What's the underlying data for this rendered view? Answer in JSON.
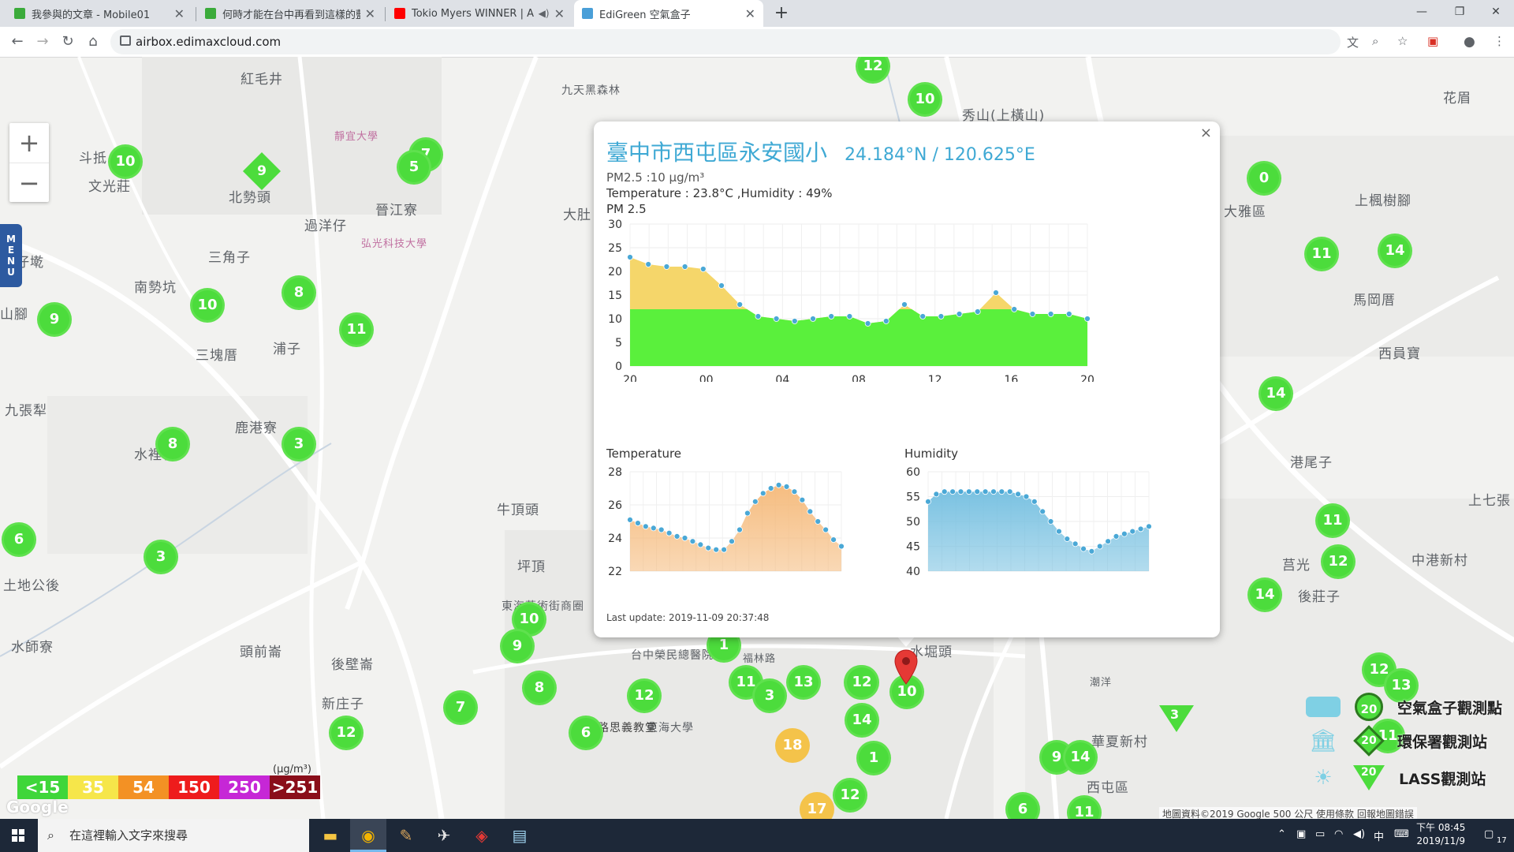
{
  "browser": {
    "tabs": [
      {
        "title": "我參與的文章 - Mobile01",
        "favicon_color": "#3bab3b"
      },
      {
        "title": "何時才能在台中再看到這樣的藍天",
        "favicon_color": "#3bab3b"
      },
      {
        "title": "Tokio Myers WINNER | ALL",
        "favicon_color": "#ff0000"
      },
      {
        "title": "EdiGreen 空氣盒子",
        "favicon_color": "#4a9fd8"
      }
    ],
    "url": "airbox.edimaxcloud.com"
  },
  "map": {
    "zoom_in": "+",
    "zoom_out": "−",
    "menu_label": [
      "M",
      "E",
      "N",
      "U"
    ],
    "places": [
      {
        "text": "紅毛井"
      },
      {
        "text": "斗抵"
      },
      {
        "text": "文光莊"
      },
      {
        "text": "北勢頭"
      },
      {
        "text": "過洋仔"
      },
      {
        "text": "晉江寮"
      },
      {
        "text": "弘光科技大學"
      },
      {
        "text": "靜宜大學"
      },
      {
        "text": "三角子"
      },
      {
        "text": "南勢坑"
      },
      {
        "text": "潭仔墘"
      },
      {
        "text": "山腳"
      },
      {
        "text": "三塊厝"
      },
      {
        "text": "浦子"
      },
      {
        "text": "九張犁"
      },
      {
        "text": "鹿港寮"
      },
      {
        "text": "水裡社"
      },
      {
        "text": "土地公後"
      },
      {
        "text": "水師寮"
      },
      {
        "text": "頭前崙"
      },
      {
        "text": "後壁崙"
      },
      {
        "text": "新庄子"
      },
      {
        "text": "牛頂頭"
      },
      {
        "text": "坪頂"
      },
      {
        "text": "東海藝術街商圈"
      },
      {
        "text": "東海大學"
      },
      {
        "text": "路思義教堂"
      },
      {
        "text": "大肚"
      },
      {
        "text": "九天黑森林"
      },
      {
        "text": "秀山(上橫山)"
      },
      {
        "text": "花眉"
      },
      {
        "text": "大雅區"
      },
      {
        "text": "上楓樹腳"
      },
      {
        "text": "馬岡厝"
      },
      {
        "text": "西員寶"
      },
      {
        "text": "港尾子"
      },
      {
        "text": "上七張"
      },
      {
        "text": "中港新村"
      },
      {
        "text": "後莊子"
      },
      {
        "text": "華夏新村"
      },
      {
        "text": "西屯區"
      },
      {
        "text": "潮洋"
      },
      {
        "text": "莒光"
      },
      {
        "text": "福林路"
      },
      {
        "text": "台中榮民總醫院"
      },
      {
        "text": "水堀頭"
      }
    ],
    "markers": [
      "12",
      "10",
      "7",
      "5",
      "9",
      "10",
      "8",
      "10",
      "11",
      "9",
      "8",
      "3",
      "6",
      "3",
      "10",
      "9",
      "8",
      "7",
      "12",
      "12",
      "6",
      "12",
      "11",
      "1",
      "3",
      "13",
      "12",
      "10",
      "14",
      "18",
      "1",
      "17",
      "12",
      "6",
      "9",
      "14",
      "11",
      "0",
      "11",
      "14",
      "14",
      "11",
      "12",
      "12",
      "13",
      "11",
      "14",
      "3",
      "10",
      "13",
      "20",
      "20",
      "20"
    ],
    "legend_unit": "(µg/m³)",
    "legend": [
      {
        "label": "<15",
        "color": "#3fd63a"
      },
      {
        "label": "35",
        "color": "#f6e64a"
      },
      {
        "label": "54",
        "color": "#f39124"
      },
      {
        "label": "150",
        "color": "#ee1c1c"
      },
      {
        "label": "250",
        "color": "#c627d6"
      },
      {
        "label": ">251",
        "color": "#8a0e1a"
      }
    ],
    "station_legend": [
      {
        "label": "空氣盒子觀測點"
      },
      {
        "label": "環保署觀測站"
      },
      {
        "label": "LASS觀測站"
      }
    ],
    "google": "Google",
    "attribution": "地圖資料©2019 Google   500 公尺         使用條款   回報地圖錯誤"
  },
  "popup": {
    "close": "×",
    "station_name": "臺中市西屯區永安國小",
    "coordinates": "24.184°N / 120.625°E",
    "pm25_line": "PM2.5 :10 µg/m³",
    "env_line": "Temperature : 23.8°C ,Humidity : 49%",
    "pm_chart_label": "PM 2.5",
    "temp_chart_label": "Temperature",
    "hum_chart_label": "Humidity",
    "last_update": "Last update: 2019-11-09 20:37:48"
  },
  "chart_data": [
    {
      "type": "area",
      "title": "PM 2.5",
      "x_ticks": [
        "20",
        "00",
        "04",
        "08",
        "12",
        "16",
        "20"
      ],
      "y_ticks": [
        0,
        5,
        10,
        15,
        20,
        25,
        30
      ],
      "ylim": [
        0,
        30
      ],
      "threshold": 12,
      "colors": {
        "below": "#5af03c",
        "above": "#f5d66a"
      },
      "values": [
        23,
        21.5,
        21,
        21,
        20.5,
        17,
        13,
        10.5,
        10,
        9.5,
        10,
        10.5,
        10.5,
        9,
        9.5,
        13,
        10.5,
        10.5,
        11,
        11.5,
        15.5,
        12,
        11,
        11,
        11,
        10
      ]
    },
    {
      "type": "area",
      "title": "Temperature",
      "y_ticks": [
        22,
        24,
        26,
        28
      ],
      "ylim": [
        22,
        28
      ],
      "color": "#f5b979",
      "values": [
        25.1,
        24.9,
        24.7,
        24.6,
        24.5,
        24.3,
        24.1,
        24,
        23.8,
        23.6,
        23.4,
        23.3,
        23.3,
        23.8,
        24.5,
        25.5,
        26.2,
        26.7,
        27,
        27.2,
        27.1,
        26.8,
        26.3,
        25.6,
        25,
        24.5,
        23.9,
        23.5
      ]
    },
    {
      "type": "area",
      "title": "Humidity",
      "y_ticks": [
        40,
        45,
        50,
        55,
        60
      ],
      "ylim": [
        40,
        60
      ],
      "color": "#74bfe0",
      "values": [
        54,
        55.5,
        56,
        56,
        56,
        56,
        56,
        56,
        56,
        56,
        56,
        55.5,
        55,
        54,
        52,
        50,
        48,
        46.5,
        45.5,
        44.5,
        44,
        45,
        46,
        47,
        47.5,
        48,
        48.5,
        49
      ]
    }
  ],
  "taskbar": {
    "search_placeholder": "在這裡輸入文字來搜尋",
    "time": "下午 08:45",
    "date": "2019/11/9",
    "ime": "中",
    "notif_count": "17"
  }
}
